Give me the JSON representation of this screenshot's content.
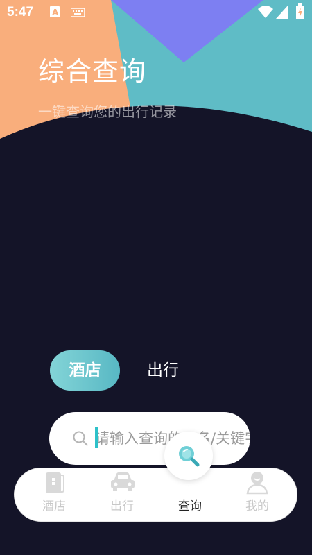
{
  "status_bar": {
    "time": "5:47",
    "icons": [
      "font-a-icon",
      "keyboard-icon",
      "wifi-icon",
      "signal-icon",
      "battery-icon"
    ]
  },
  "header": {
    "title": "综合查询",
    "subtitle": "一键查询您的出行记录"
  },
  "tabs": [
    {
      "label": "酒店",
      "active": true
    },
    {
      "label": "出行",
      "active": false
    }
  ],
  "search": {
    "placeholder": "请输入查询的...名/关键字"
  },
  "bottom_nav": {
    "items": [
      {
        "label": "酒店",
        "icon": "hotel-door-icon"
      },
      {
        "label": "出行",
        "icon": "car-icon"
      },
      {
        "label": "查询",
        "icon": "magnifier-icon",
        "active": true
      },
      {
        "label": "我的",
        "icon": "user-icon"
      }
    ]
  },
  "colors": {
    "background": "#141428",
    "orange": "#f9ae7c",
    "purple": "#7d7ff2",
    "teal": "#5fbcc6",
    "accent": "#58b8c4"
  }
}
